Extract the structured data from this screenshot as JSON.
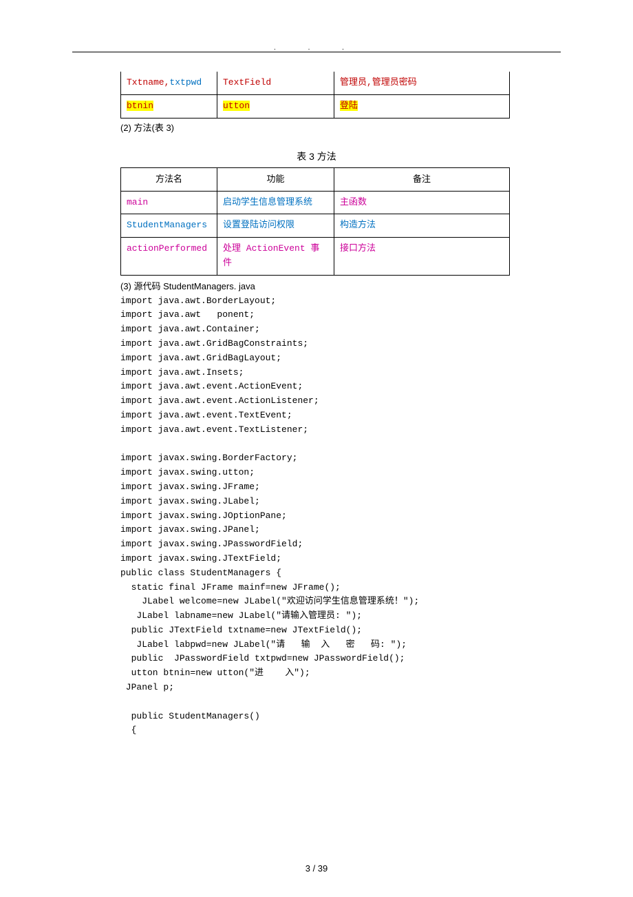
{
  "table1": {
    "r1": {
      "c1a": "Txtname,",
      "c1b": "txtpwd",
      "c2": "TextField",
      "c3": "管理员,管理员密码"
    },
    "r2": {
      "c1": "btnin",
      "c2": "utton",
      "c3": "登陆"
    }
  },
  "line_methods": "(2) 方法(表 3)",
  "table3_caption": "表 3 方法",
  "table3": {
    "h1": "方法名",
    "h2": "功能",
    "h3": "备注",
    "r1": {
      "c1": "main",
      "c2": "启动学生信息管理系统",
      "c3": "主函数"
    },
    "r2": {
      "c1": "StudentManagers",
      "c2": "设置登陆访问权限",
      "c3": "构造方法"
    },
    "r3": {
      "c1": "actionPerformed",
      "c2": "处理 ActionEvent 事件",
      "c3": "接口方法"
    }
  },
  "source_title": "(3) 源代码 StudentManagers. java",
  "code": [
    "import java.awt.BorderLayout;",
    "import java.awt   ponent;",
    "import java.awt.Container;",
    "import java.awt.GridBagConstraints;",
    "import java.awt.GridBagLayout;",
    "import java.awt.Insets;",
    "import java.awt.event.ActionEvent;",
    "import java.awt.event.ActionListener;",
    "import java.awt.event.TextEvent;",
    "import java.awt.event.TextListener;",
    "",
    "import javax.swing.BorderFactory;",
    "import javax.swing.utton;",
    "import javax.swing.JFrame;",
    "import javax.swing.JLabel;",
    "import javax.swing.JOptionPane;",
    "import javax.swing.JPanel;",
    "import javax.swing.JPasswordField;",
    "import javax.swing.JTextField;",
    "public class StudentManagers {",
    "  static final JFrame mainf=new JFrame();",
    "    JLabel welcome=new JLabel(\"欢迎访问学生信息管理系统！\");",
    "   JLabel labname=new JLabel(\"请输入管理员: \");",
    "  public JTextField txtname=new JTextField();",
    "   JLabel labpwd=new JLabel(\"请   输  入   密   码: \");",
    "  public  JPasswordField txtpwd=new JPasswordField();",
    "  utton btnin=new utton(\"进    入\");",
    " JPanel p;",
    " ",
    "  public StudentManagers()",
    "  {"
  ],
  "page_num": "3 / 39"
}
